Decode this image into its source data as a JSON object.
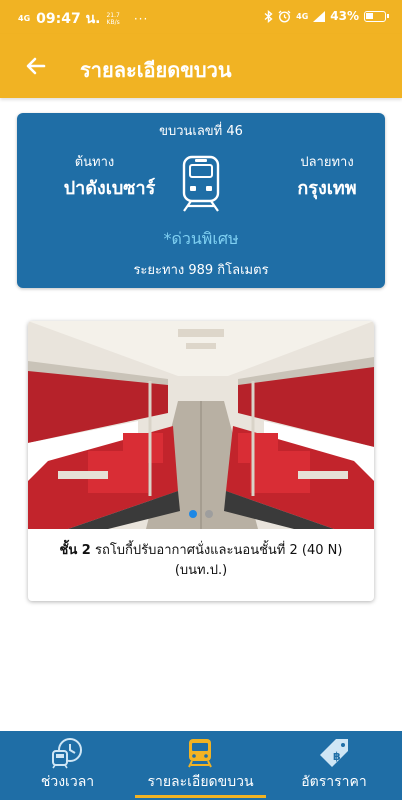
{
  "status_bar": {
    "network": "4G",
    "time": "09:47 น.",
    "speed_value": "21.7",
    "speed_unit": "KB/s",
    "more": "···",
    "cell": "4G",
    "battery_percent": "43%",
    "battery_level": 0.43
  },
  "header": {
    "title": "รายละเอียดขบวน",
    "back_icon": "arrow-left-icon"
  },
  "train_card": {
    "train_number": "ขบวนเลขที่ 46",
    "origin_label": "ต้นทาง",
    "origin": "ปาดังเบซาร์",
    "destination_label": "ปลายทาง",
    "destination": "กรุงเทพ",
    "train_type": "*ด่วนพิเศษ",
    "distance": "ระยะทาง 989 กิโลเมตร",
    "icon": "train-front-icon"
  },
  "carriage": {
    "class_label": "ชั้น 2",
    "description": "รถโบกี้ปรับอากาศนั่งและนอนชั้นที่ 2 (40 N)",
    "code": "(บนท.ป.)",
    "carousel_dots": 2,
    "active_dot": 0
  },
  "bottom_nav": {
    "items": [
      {
        "label": "ช่วงเวลา",
        "icon": "train-clock-icon",
        "active": false
      },
      {
        "label": "รายละเอียดขบวน",
        "icon": "train-icon",
        "active": true
      },
      {
        "label": "อัตราราคา",
        "icon": "price-tag-icon",
        "active": false
      }
    ]
  },
  "colors": {
    "primary_yellow": "#f1b323",
    "primary_blue": "#1f6ea6",
    "accent_light_blue": "#7fd0f2"
  }
}
